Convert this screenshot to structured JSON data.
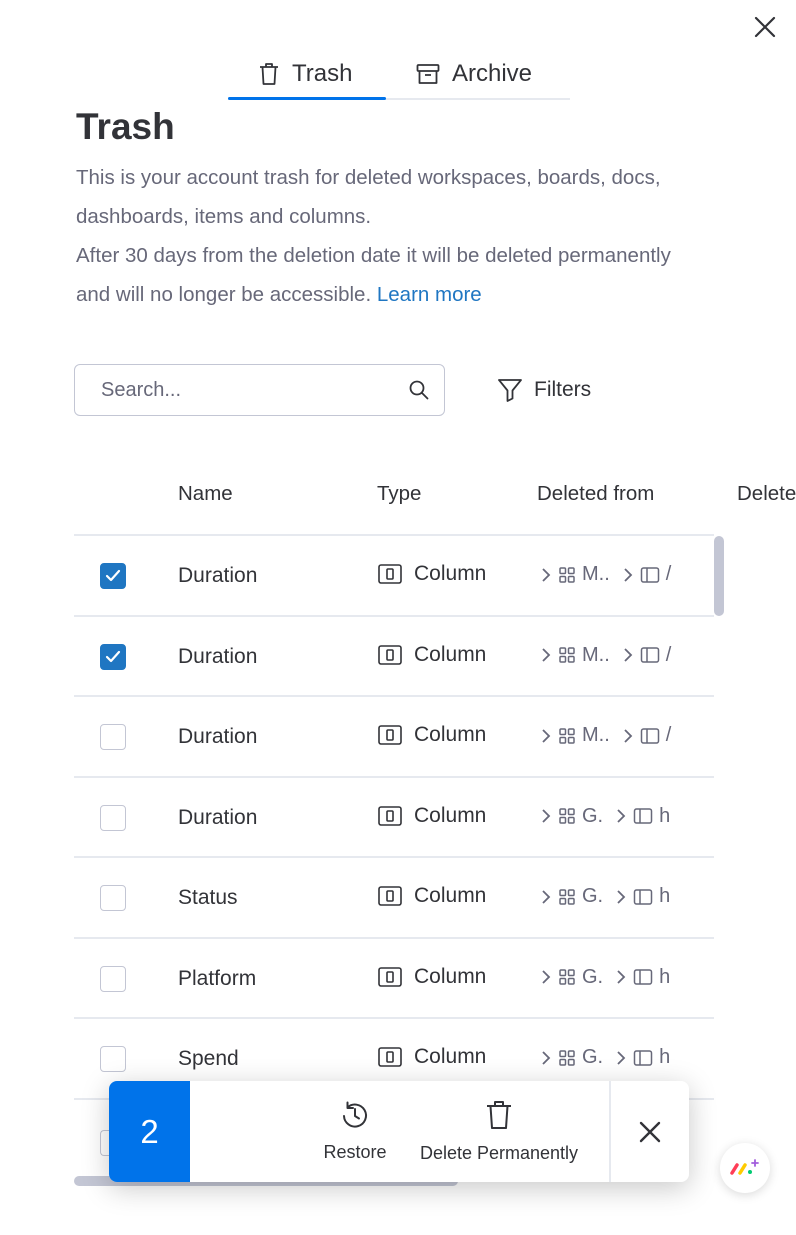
{
  "tabs": [
    {
      "label": "Trash",
      "icon": "trash-icon",
      "active": true
    },
    {
      "label": "Archive",
      "icon": "archive-box-icon",
      "active": false
    }
  ],
  "page": {
    "title": "Trash",
    "description_1": "This is your account trash for deleted workspaces, boards, docs, dashboards, items and columns.",
    "description_2": "After 30 days from the deletion date it will be deleted permanently and will no longer be accessible.",
    "learn_more": "Learn more"
  },
  "search": {
    "placeholder": "Search...",
    "value": ""
  },
  "filters": {
    "label": "Filters"
  },
  "table": {
    "columns": [
      "Name",
      "Type",
      "Deleted from",
      "Delete"
    ],
    "rows": [
      {
        "checked": true,
        "name": "Duration",
        "type": "Column",
        "path_1": "M..",
        "path_2": "/"
      },
      {
        "checked": true,
        "name": "Duration",
        "type": "Column",
        "path_1": "M..",
        "path_2": "/"
      },
      {
        "checked": false,
        "name": "Duration",
        "type": "Column",
        "path_1": "M..",
        "path_2": "/"
      },
      {
        "checked": false,
        "name": "Duration",
        "type": "Column",
        "path_1": "G.",
        "path_2": "h"
      },
      {
        "checked": false,
        "name": "Status",
        "type": "Column",
        "path_1": "G.",
        "path_2": "h"
      },
      {
        "checked": false,
        "name": "Platform",
        "type": "Column",
        "path_1": "G.",
        "path_2": "h"
      },
      {
        "checked": false,
        "name": "Spend",
        "type": "Column",
        "path_1": "G.",
        "path_2": "h"
      }
    ]
  },
  "action_bar": {
    "selected_count": "2",
    "restore_label": "Restore",
    "delete_label": "Delete Permanently"
  },
  "colors": {
    "accent": "#0073ea",
    "checkbox": "#1f76c2",
    "link": "#1f76c2",
    "text": "#323338",
    "muted": "#676879",
    "border": "#e6e9ef"
  }
}
